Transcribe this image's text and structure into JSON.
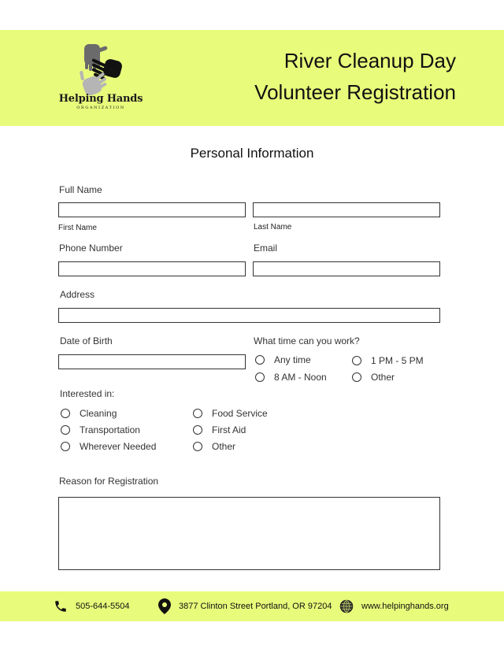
{
  "header": {
    "org_name": "Helping Hands",
    "org_subtitle": "ORGANIZATION",
    "title_line1": "River Cleanup Day",
    "title_line2": "Volunteer Registration"
  },
  "form": {
    "section_title": "Personal Information",
    "full_name_label": "Full Name",
    "first_name_label": "First Name",
    "last_name_label": "Last Name",
    "first_name_value": "",
    "last_name_value": "",
    "phone_label": "Phone Number",
    "phone_value": "",
    "email_label": "Email",
    "email_value": "",
    "address_label": "Address",
    "address_value": "",
    "dob_label": "Date of Birth",
    "dob_value": "",
    "work_time_label": "What time can you work?",
    "work_time_options": [
      "Any time",
      "1 PM - 5 PM",
      "8 AM - Noon",
      "Other"
    ],
    "interests_label": "Interested in:",
    "interest_options": [
      "Cleaning",
      "Food Service",
      "Transportation",
      "First Aid",
      "Wherever Needed",
      "Other"
    ],
    "reason_label": "Reason for Registration",
    "reason_value": ""
  },
  "footer": {
    "phone": "505-644-5504",
    "address": "3877 Clinton Street Portland, OR 97204",
    "website": "www.helpinghands.org"
  },
  "colors": {
    "accent": "#e9fb7b"
  }
}
